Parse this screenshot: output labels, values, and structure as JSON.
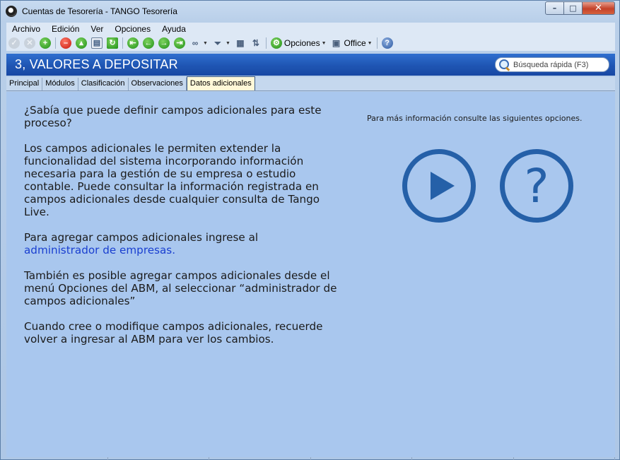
{
  "window": {
    "title": "Cuentas de Tesorería - TANGO Tesorería",
    "controls": {
      "minimize": "–",
      "maximize": "□",
      "close": "✕"
    }
  },
  "menu": [
    {
      "label": "Archivo"
    },
    {
      "label": "Edición"
    },
    {
      "label": "Ver"
    },
    {
      "label": "Opciones"
    },
    {
      "label": "Ayuda"
    }
  ],
  "toolbar": {
    "options_label": "Opciones",
    "office_label": "Office",
    "icons": [
      "check-icon",
      "cancel-icon",
      "add-icon",
      "delete-icon",
      "print-icon",
      "export-icon",
      "refresh-icon",
      "first-icon",
      "prev-icon",
      "next-icon",
      "last-icon",
      "binoculars-icon",
      "filter-icon",
      "grid-icon",
      "sort-icon",
      "options-icon",
      "office-icon",
      "help-icon"
    ]
  },
  "header": {
    "title": "3, VALORES A DEPOSITAR",
    "search_placeholder": "Búsqueda rápida (F3)"
  },
  "tabs": [
    {
      "label": "Principal",
      "active": false
    },
    {
      "label": "Módulos",
      "active": false
    },
    {
      "label": "Clasificación",
      "active": false
    },
    {
      "label": "Observaciones",
      "active": false
    },
    {
      "label": "Datos adicionales",
      "active": true
    }
  ],
  "content": {
    "question": "¿Sabía que puede definir campos adicionales para este proceso?",
    "paragraph1": "Los campos adicionales le permiten extender la funcionalidad del sistema incorporando información necesaria para la gestión de su empresa o estudio contable. Puede consultar la información registrada en campos adicionales desde cualquier consulta de Tango Live.",
    "paragraph2_prefix": "Para agregar campos adicionales ingrese al",
    "paragraph2_link": "administrador de empresas.",
    "paragraph3": "También es posible agregar campos adicionales desde el menú Opciones del ABM, al seleccionar “administrador de campos adicionales”",
    "paragraph4": "Cuando cree o modifique campos adicionales, recuerde volver a ingresar al ABM para ver los cambios.",
    "info": "Para más información consulte las siguientes opciones.",
    "help_glyph": "?"
  },
  "colors": {
    "header_blue": "#1f55b3",
    "accent_blue": "#2560a8",
    "link_blue": "#1a3fd0",
    "content_bg": "#a9c7ee"
  }
}
